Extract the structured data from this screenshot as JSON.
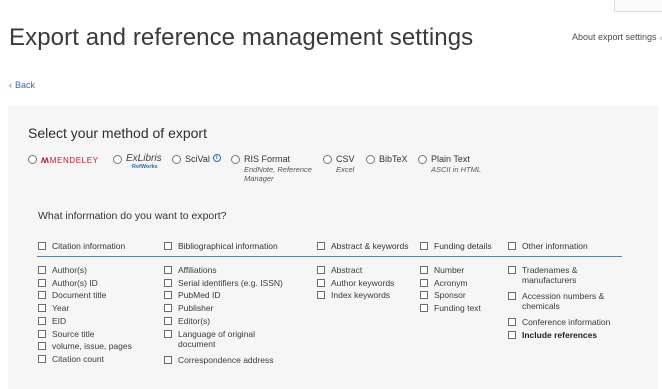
{
  "header": {
    "title": "Export and reference management settings",
    "about_link": "About export settings",
    "about_icon": "external-link-icon",
    "back_label": "Back"
  },
  "export_method": {
    "section_title": "Select your method of export",
    "options": [
      {
        "label": "MENDELEY",
        "logo": "mendeley-logo",
        "selected": false
      },
      {
        "label": "ExLibris",
        "sublabel": "RefWorks",
        "logo": "exlibris-refworks-logo",
        "selected": false
      },
      {
        "label": "SciVal",
        "icon": "info-icon",
        "selected": false
      },
      {
        "label": "RIS Format",
        "sublabel": "EndNote, Reference Manager",
        "selected": false
      },
      {
        "label": "CSV",
        "sublabel": "Excel",
        "selected": false
      },
      {
        "label": "BibTeX",
        "selected": false
      },
      {
        "label": "Plain Text",
        "sublabel": "ASCII in HTML",
        "selected": false
      }
    ]
  },
  "export_info": {
    "question": "What information do you want to export?",
    "columns": [
      {
        "heading": "Citation information",
        "items": [
          "Author(s)",
          "Author(s) ID",
          "Document title",
          "Year",
          "EID",
          "Source title",
          "volume, issue, pages",
          "Citation count"
        ]
      },
      {
        "heading": "Bibliographical information",
        "items": [
          "Affiliations",
          "Serial identifiers (e.g. ISSN)",
          "PubMed ID",
          "Publisher",
          "Editor(s)",
          "Language of original document",
          "Correspondence address"
        ]
      },
      {
        "heading": "Abstract & keywords",
        "items": [
          "Abstract",
          "Author keywords",
          "Index keywords"
        ]
      },
      {
        "heading": "Funding details",
        "items": [
          "Number",
          "Acronym",
          "Sponsor",
          "Funding text"
        ]
      },
      {
        "heading": "Other information",
        "items": [
          "Tradenames & manufacturers",
          "Accession numbers & chemicals",
          "Conference information",
          "Include references"
        ]
      }
    ]
  }
}
